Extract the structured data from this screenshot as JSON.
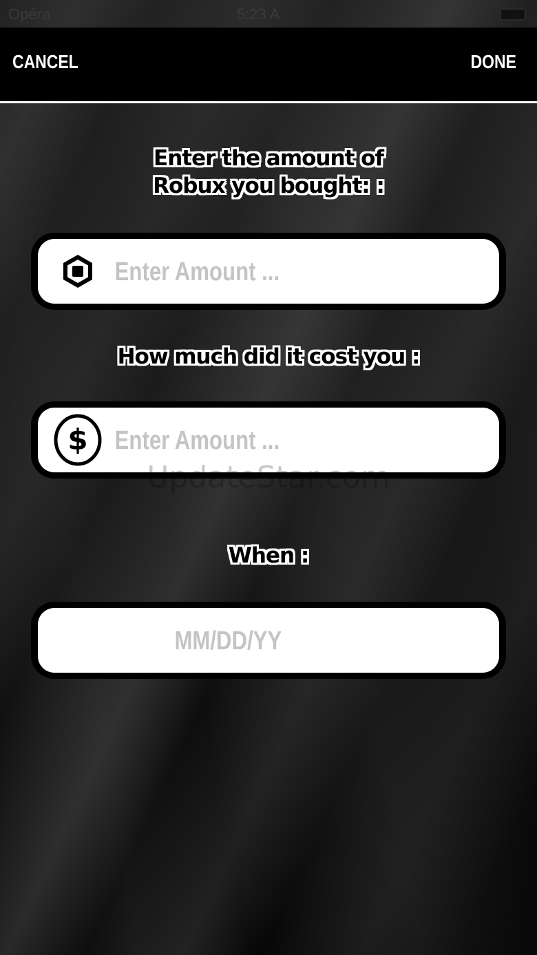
{
  "status_bar": {
    "carrier": "Opéra",
    "time": "5:23 A"
  },
  "nav": {
    "cancel_label": "CANCEL",
    "done_label": "DONE"
  },
  "form": {
    "robux_label_line1": "Enter the amount of",
    "robux_label_line2": "Robux you bought: :",
    "robux_placeholder": "Enter Amount ...",
    "cost_label": "How much did it cost you :",
    "cost_placeholder": "Enter Amount ...",
    "when_label": "When :",
    "date_placeholder": "MM/DD/YY"
  },
  "icons": {
    "robux": "robux-icon",
    "dollar": "dollar-icon"
  },
  "watermark": "UpdateStar.com",
  "colors": {
    "field_background": "#ffffff",
    "placeholder": "#c4c4c4",
    "nav_text": "#ffffff"
  }
}
